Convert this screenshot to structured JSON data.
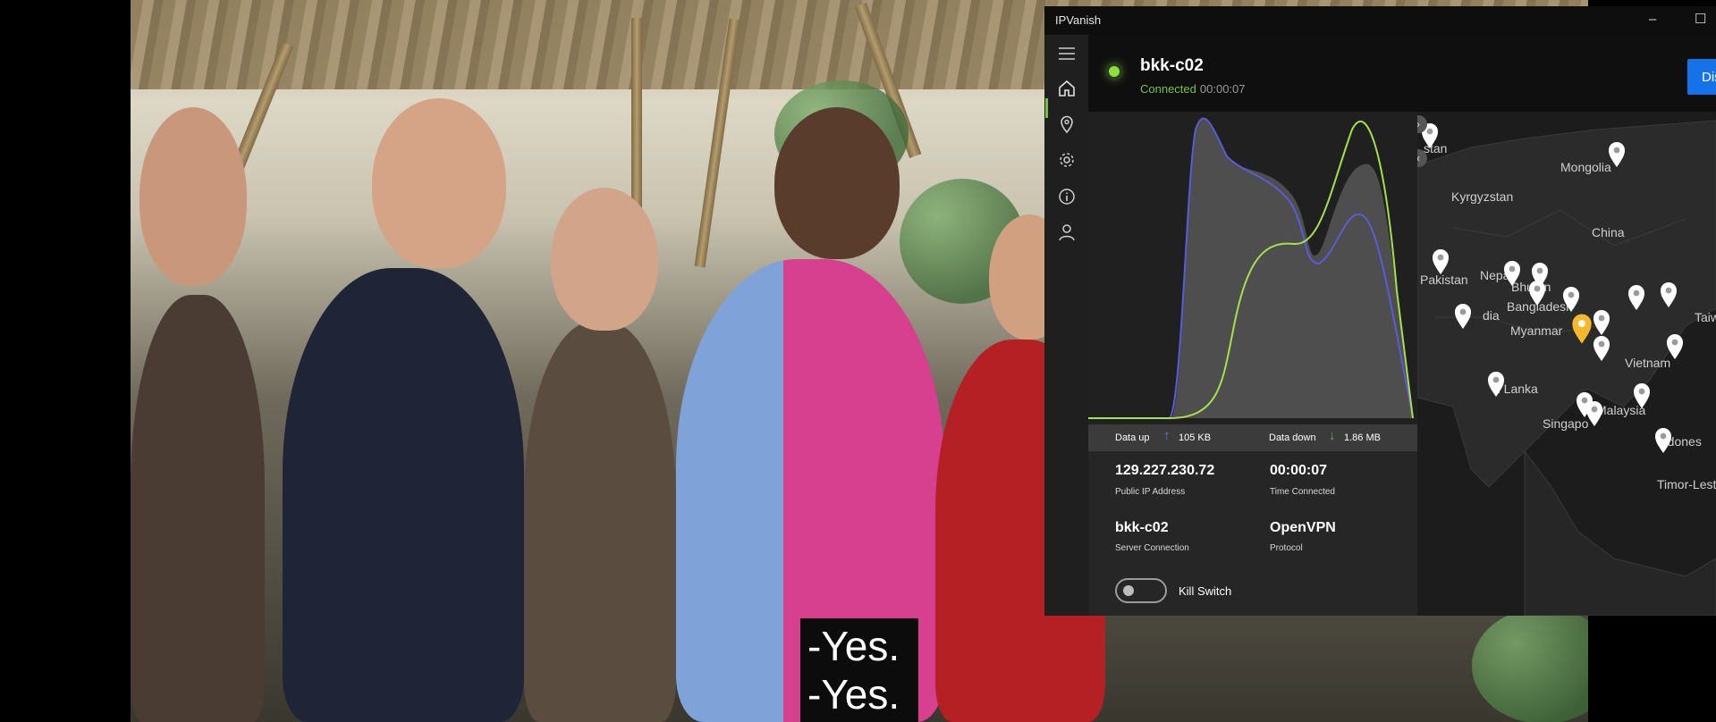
{
  "subtitle": {
    "lines": [
      "-Yes.",
      "-Yes."
    ]
  },
  "app": {
    "title": "IPVanish",
    "window_controls": {
      "minimize": "–",
      "maximize": "☐"
    },
    "sidebar": [
      {
        "name": "menu-icon"
      },
      {
        "name": "home-icon",
        "active": true
      },
      {
        "name": "location-icon"
      },
      {
        "name": "settings-icon"
      },
      {
        "name": "info-icon"
      },
      {
        "name": "account-icon"
      }
    ],
    "header": {
      "server": "bkk-c02",
      "status": "Connected",
      "elapsed": "00:00:07",
      "disconnect_label": "Disconnect"
    },
    "stats": {
      "data_up_label": "Data up",
      "data_up_value": "105 KB",
      "data_down_label": "Data down",
      "data_down_value": "1.86 MB"
    },
    "details": {
      "ip": "129.227.230.72",
      "ip_label": "Public IP Address",
      "time": "00:00:07",
      "time_label": "Time Connected",
      "server": "bkk-c02",
      "server_label": "Server Connection",
      "protocol": "OpenVPN",
      "protocol_label": "Protocol"
    },
    "kill_switch": {
      "label": "Kill Switch",
      "enabled": false
    },
    "map": {
      "labels": [
        "stan",
        "Mongolia",
        "Kyrgyzstan",
        "China",
        "Pakistan",
        "Nepal",
        "Bhutan",
        "Bangladesh",
        "dia",
        "Myanmar",
        "Taiw",
        "Vietnam",
        "ri Lanka",
        "Malaysia",
        "Singapo",
        "Indones",
        "Timor-Lest"
      ],
      "prev_arrow": "‹",
      "next_arrow": "›"
    },
    "colors": {
      "accent_green": "#75c43f",
      "button_blue": "#1572e8",
      "graph_up": "#5b5bd8",
      "graph_down": "#a7e04a",
      "pin_active": "#f5b72c",
      "pin_default": "#ffffff"
    }
  }
}
